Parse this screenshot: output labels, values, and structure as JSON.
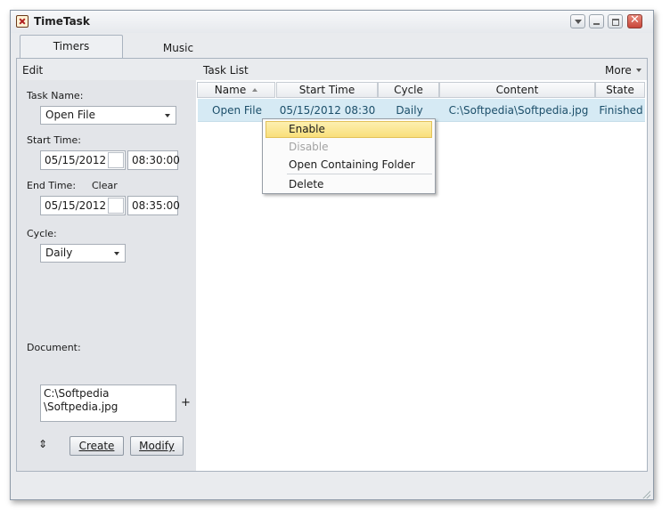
{
  "window": {
    "title": "TimeTask"
  },
  "tabs": [
    {
      "label": "Timers",
      "active": true
    },
    {
      "label": "Music",
      "active": false
    }
  ],
  "toolbar": {
    "edit_label": "Edit",
    "tasklist_label": "Task List",
    "more_label": "More"
  },
  "form": {
    "task_name_label": "Task Name:",
    "task_name_value": "Open File",
    "start_time_label": "Start Time:",
    "start_date": "05/15/2012",
    "start_time": "08:30:00",
    "end_time_label": "End Time:",
    "clear_label": "Clear",
    "end_date": "05/15/2012",
    "end_time": "08:35:00",
    "cycle_label": "Cycle:",
    "cycle_value": "Daily",
    "document_label": "Document:",
    "document_line1": "C:\\Softpedia",
    "document_line2": "\\Softpedia.jpg",
    "add_symbol": "+",
    "create_label": "Create",
    "modify_label": "Modify"
  },
  "grid": {
    "columns": [
      "Name",
      "Start Time",
      "Cycle",
      "Content",
      "State"
    ],
    "rows": [
      {
        "name": "Open File",
        "start": "05/15/2012 08:30",
        "cycle": "Daily",
        "content": "C:\\Softpedia\\Softpedia.jpg",
        "state": "Finished"
      }
    ]
  },
  "context_menu": {
    "items": [
      "Enable",
      "Disable",
      "Open Containing Folder",
      "Delete"
    ],
    "highlighted": "Enable",
    "disabled": [
      "Disable"
    ]
  },
  "colors": {
    "selection_row": "#d6eaf4",
    "menu_highlight": "#f9df7a",
    "close_button": "#c8463a"
  },
  "icons": [
    "app-icon",
    "window-menu-icon",
    "minimize-icon",
    "restore-icon",
    "close-icon",
    "calendar-icon",
    "swap-icon",
    "sort-ascending-icon",
    "chevron-down-icon"
  ]
}
